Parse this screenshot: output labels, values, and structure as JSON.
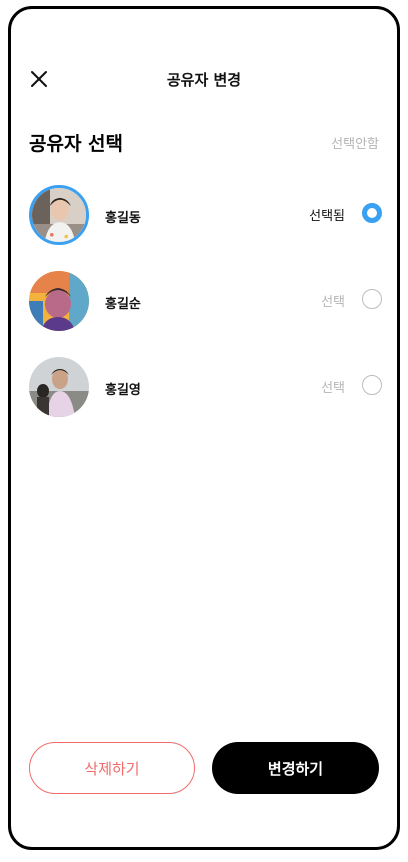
{
  "header": {
    "title": "공유자 변경",
    "close_icon": "close-icon"
  },
  "section": {
    "title": "공유자 선택",
    "unselect_label": "선택안함"
  },
  "sharers": [
    {
      "name": "홍길동",
      "status": "선택됨",
      "selected": true,
      "avatar": "photo-avatar"
    },
    {
      "name": "홍길순",
      "status": "선택",
      "selected": false,
      "avatar": "photo-avatar"
    },
    {
      "name": "홍길영",
      "status": "선택",
      "selected": false,
      "avatar": "photo-avatar"
    }
  ],
  "actions": {
    "delete_label": "삭제하기",
    "change_label": "변경하기"
  },
  "colors": {
    "accent": "#3aa0f2",
    "danger": "#f26b6b",
    "primary_button": "#000000",
    "muted_text": "#b5b5b5"
  }
}
